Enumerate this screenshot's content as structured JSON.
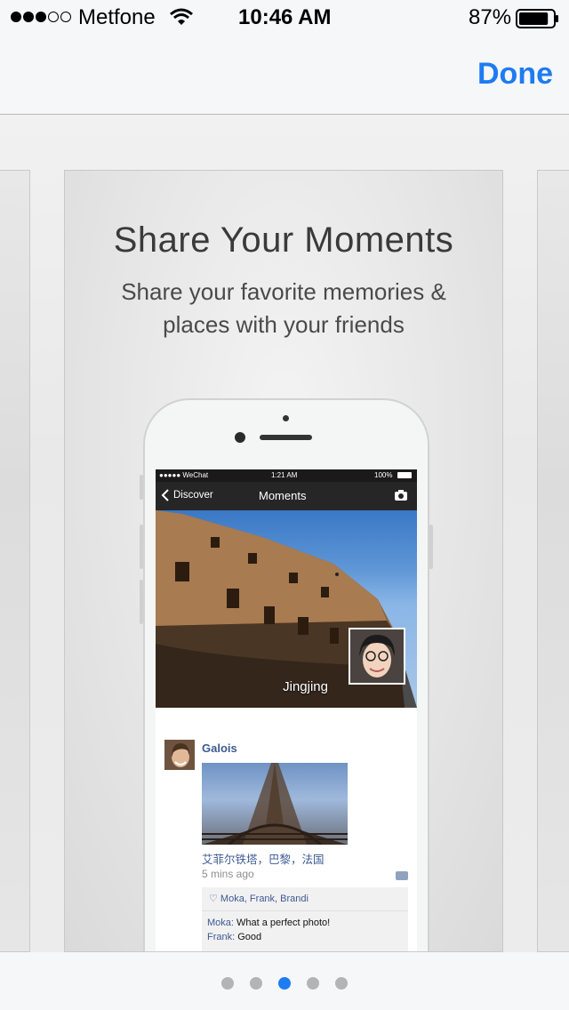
{
  "status_bar": {
    "carrier": "Metfone",
    "time": "10:46 AM",
    "battery_percent": "87%",
    "signal_bars": [
      true,
      true,
      true,
      false,
      false
    ],
    "battery_level": 0.87
  },
  "nav": {
    "done_label": "Done"
  },
  "card": {
    "title": "Share Your Moments",
    "subtitle": "Share your favorite memories & places with your friends"
  },
  "preview": {
    "status_carrier": "●●●●● WeChat",
    "status_time": "1:21 AM",
    "status_battery": "100%",
    "back_label": "Discover",
    "title": "Moments",
    "cover_name": "Jingjing",
    "post": {
      "author": "Galois",
      "caption": "艾菲尔铁塔，巴黎，法国",
      "time": "5 mins ago",
      "likes": "Moka, Frank, Brandi",
      "comments": [
        {
          "name": "Moka:",
          "text": "What a perfect photo!"
        },
        {
          "name": "Frank:",
          "text": "Good"
        }
      ]
    }
  },
  "page_control": {
    "count": 5,
    "current": 3
  },
  "colors": {
    "accent": "#1d7cf2",
    "link": "#3d5a93",
    "nav_background": "#f6f7f9",
    "dot_inactive": "#b4b4b4"
  },
  "icons": [
    "wifi-icon",
    "battery-icon",
    "back-chevron-icon",
    "camera-icon",
    "heart-icon",
    "comment-icon"
  ]
}
